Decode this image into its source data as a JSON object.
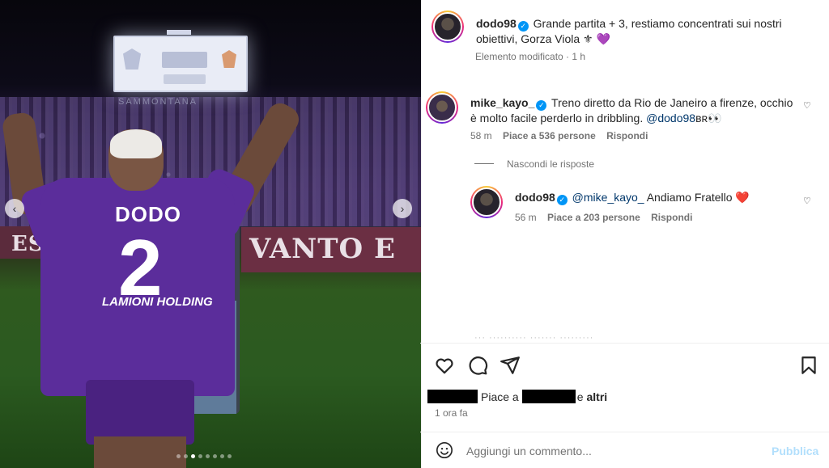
{
  "post": {
    "author": "dodo98",
    "caption": "Grande partita + 3, restiamo concentrati sui nostri obiettivi, Gorza Viola ⚜️💜",
    "caption_line1": "Grande partita + 3, restiamo concentrati sui nostri",
    "caption_line2": "obiettivi, Gorza Viola ⚜ 💜",
    "edited_label": "Elemento modificato · 1 h",
    "photo": {
      "jersey_name": "DODO",
      "jersey_number": "2",
      "sponsor": "LAMIONI HOLDING",
      "banner_left": "ESSER",
      "banner_right": "VANTO E",
      "stadium_sign": "SAMMONTANA",
      "carousel_dots": 8,
      "active_dot": 2
    }
  },
  "comments": [
    {
      "user": "mike_kayo_",
      "text_line1": "Treno diretto da Rio de Janeiro a firenze, occhio",
      "text_line2_pre": "è molto facile perderlo in dribbling. ",
      "mention": "@dodo98",
      "emoji_tail": "ʙʀ👀",
      "time": "58 m",
      "likes": "Piace a 536 persone",
      "reply_label": "Rispondi",
      "hide_replies": "Nascondi le risposte",
      "replies": [
        {
          "user": "dodo98",
          "mention": "@mike_kayo_",
          "text": " Andiamo Fratello ❤️",
          "time": "56 m",
          "likes": "Piace a 203 persone",
          "reply_label": "Rispondi"
        }
      ]
    }
  ],
  "likes": {
    "prefix": "Piace a",
    "suffix": "e",
    "others": "altri"
  },
  "post_time": "1 ora fa",
  "comment_box": {
    "placeholder": "Aggiungi un commento...",
    "publish": "Pubblica"
  },
  "colors": {
    "verified": "#0095f6",
    "link": "#00376b",
    "publish_disabled": "#b2dffc",
    "jersey": "#5b2d9b"
  }
}
